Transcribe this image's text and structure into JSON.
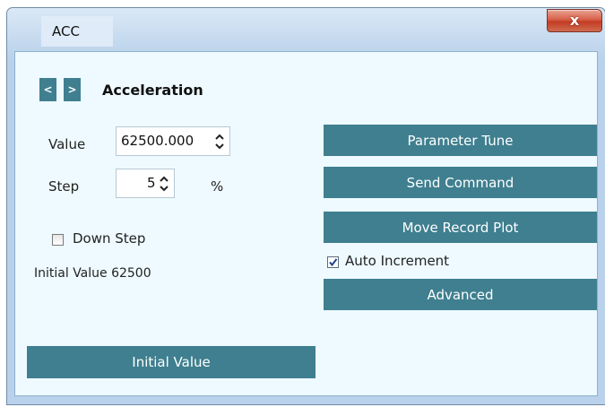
{
  "window": {
    "title": "ACC",
    "close_glyph": "x"
  },
  "nav": {
    "prev_label": "<",
    "next_label": ">",
    "heading": "Acceleration"
  },
  "value_field": {
    "label": "Value",
    "value": "62500.000"
  },
  "step_field": {
    "label": "Step",
    "value": "5",
    "unit": "%"
  },
  "down_step": {
    "label": "Down Step",
    "checked": false
  },
  "initial_value_text": "Initial Value 62500",
  "buttons": {
    "parameter_tune": "Parameter Tune",
    "send_command": "Send Command",
    "move_record_plot": "Move Record Plot",
    "advanced": "Advanced",
    "initial_value": "Initial Value"
  },
  "auto_increment": {
    "label": "Auto Increment",
    "checked": true
  },
  "colors": {
    "button_teal": "#3f7f8f",
    "panel_background": "#eefaff",
    "close_red": "#c33d24"
  },
  "icons": [
    "close-icon",
    "chevron-left-icon",
    "chevron-right-icon",
    "spin-up-icon",
    "spin-down-icon",
    "checkmark-icon"
  ]
}
